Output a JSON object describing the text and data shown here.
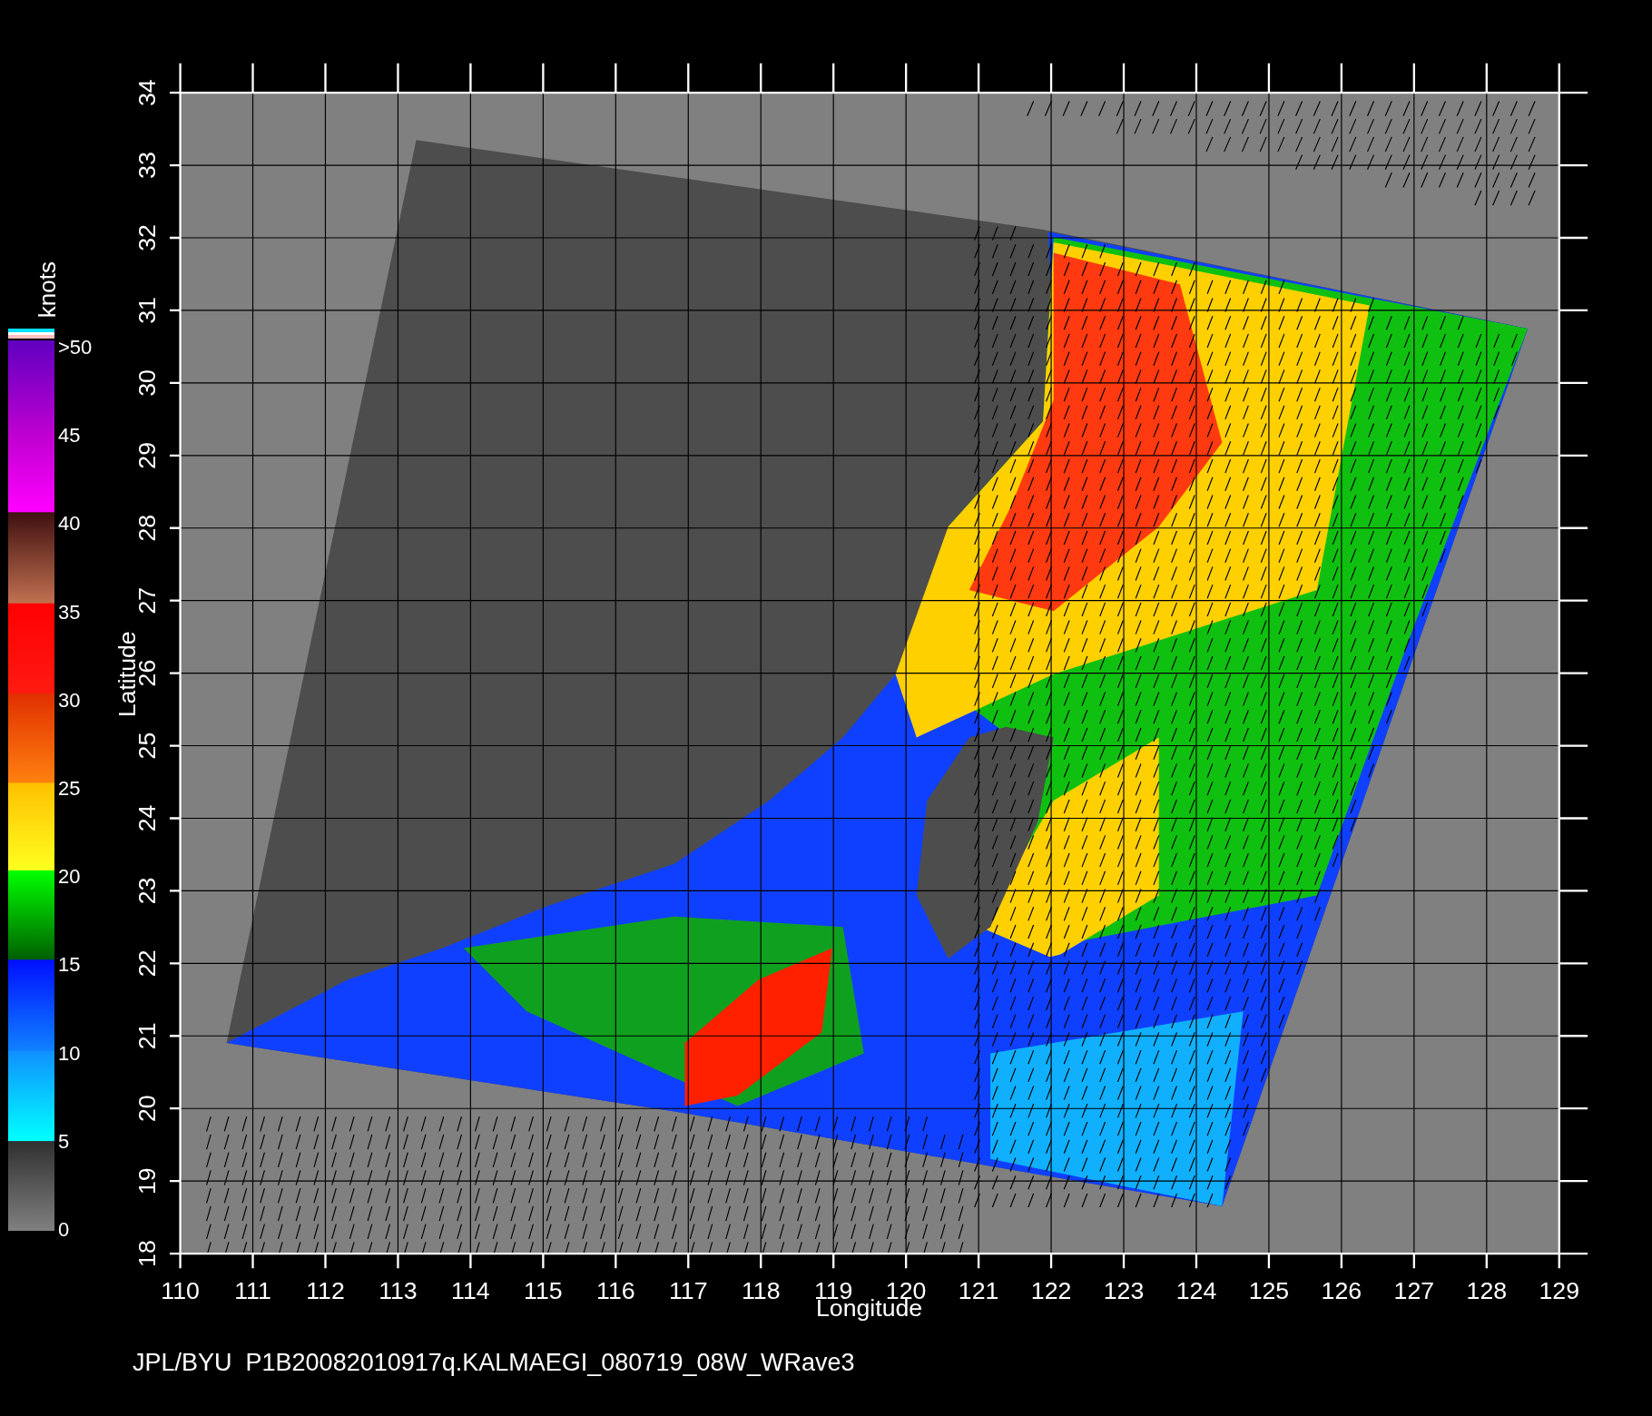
{
  "colorbar": {
    "unit": "knots",
    "labels": [
      ">50",
      "45",
      "40",
      "35",
      "30",
      "25",
      "20",
      "15",
      "10",
      "5",
      "0"
    ]
  },
  "map": {
    "xlabel": "Longitude",
    "ylabel": "Latitude",
    "xticks": [
      "110",
      "111",
      "112",
      "113",
      "114",
      "115",
      "116",
      "117",
      "118",
      "119",
      "120",
      "121",
      "122",
      "123",
      "124",
      "125",
      "126",
      "127",
      "128",
      "129"
    ],
    "yticks": [
      "34",
      "33",
      "32",
      "31",
      "30",
      "29",
      "28",
      "27",
      "26",
      "25",
      "24",
      "23",
      "22",
      "21",
      "20",
      "19",
      "18"
    ]
  },
  "caption": "JPL/BYU  P1B20082010917q.KALMAEGI_080719_08W_WRave3"
}
